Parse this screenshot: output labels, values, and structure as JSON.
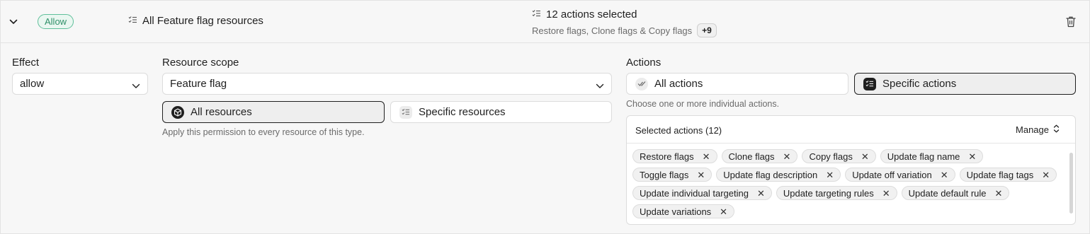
{
  "header": {
    "effect_badge": "Allow",
    "resource_title": "All Feature flag resources",
    "actions_title": "12 actions selected",
    "actions_sub": "Restore flags, Clone flags & Copy flags",
    "more_count": "+9"
  },
  "effect": {
    "label": "Effect",
    "value": "allow"
  },
  "resource_scope": {
    "label": "Resource scope",
    "value": "Feature flag",
    "all_resources": "All resources",
    "specific_resources": "Specific resources",
    "help": "Apply this permission to every resource of this type."
  },
  "actions": {
    "label": "Actions",
    "all_actions": "All actions",
    "specific_actions": "Specific actions",
    "help": "Choose one or more individual actions.",
    "selected_title": "Selected actions (12)",
    "manage_label": "Manage",
    "chips": [
      "Restore flags",
      "Clone flags",
      "Copy flags",
      "Update flag name",
      "Toggle flags",
      "Update flag description",
      "Update off variation",
      "Update flag tags",
      "Update individual targeting",
      "Update targeting rules",
      "Update default rule",
      "Update variations"
    ]
  },
  "icons": {
    "collapse": "chevron-down-icon",
    "list": "checklist-icon",
    "delete": "trash-icon",
    "all_resources": "cube-icon",
    "all_actions": "double-check-icon",
    "specific_actions": "checklist-icon",
    "manage": "chevrons-up-down-icon",
    "remove": "close-icon"
  },
  "colors": {
    "badge_border": "#5fbf9a",
    "badge_bg": "#eaf7f1",
    "badge_text": "#2f8f68"
  }
}
